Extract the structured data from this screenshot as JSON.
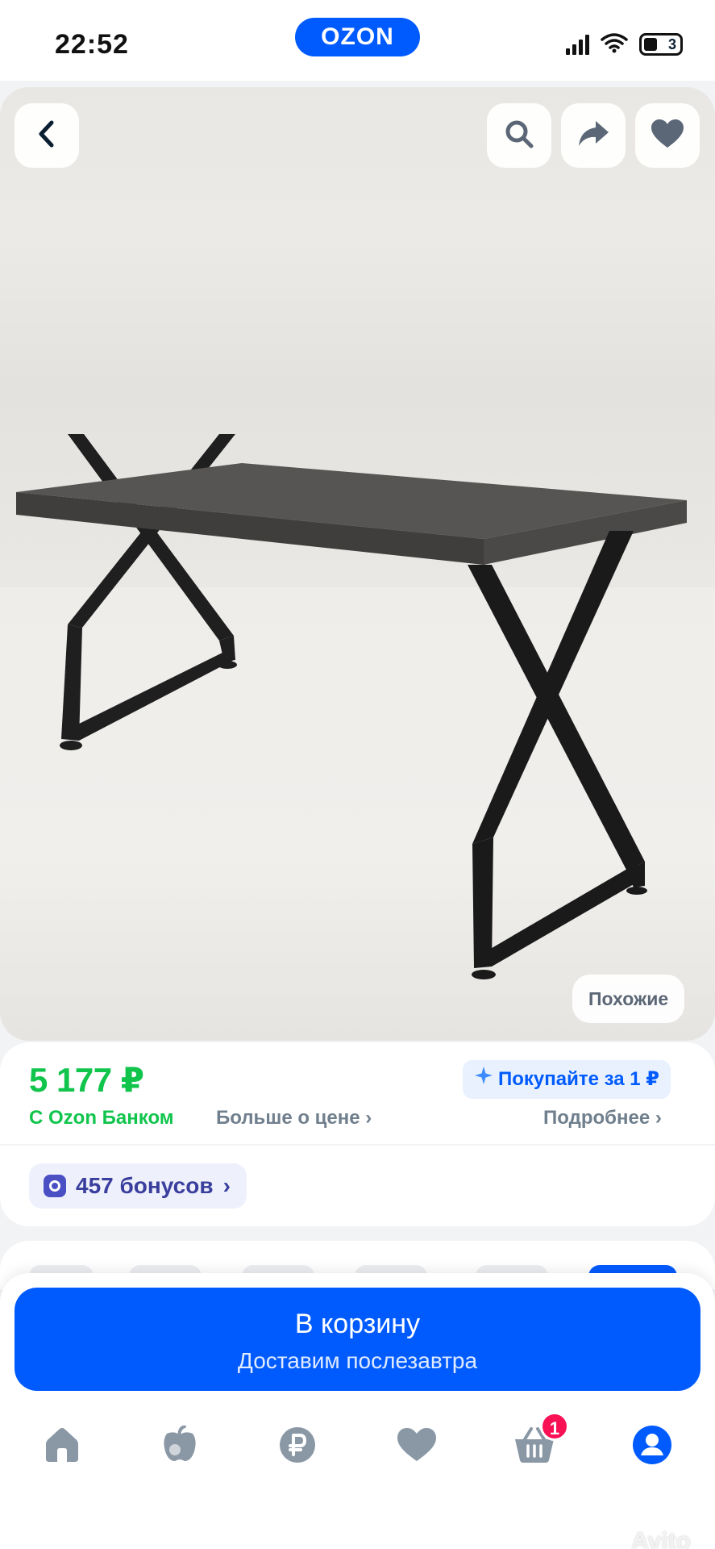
{
  "status_bar": {
    "time": "22:52",
    "battery": "3"
  },
  "brand": {
    "logo_text": "OZON",
    "accent": "#005bff"
  },
  "product_image": {
    "actions": [
      "back",
      "search",
      "share",
      "favorite"
    ],
    "similar_label": "Похожие"
  },
  "price_card": {
    "price": "5 177 ₽",
    "price_color": "#10c44c",
    "bank_label": "С Ozon Банком",
    "more_price_label": "Больше о цене",
    "promo_label": "Покупайте за 1 ₽",
    "details_label": "Подробнее",
    "bonus_label": "457 бонусов"
  },
  "bottom_sheet": {
    "cart_label": "В корзину",
    "cart_sub": "Доставим послезавтра"
  },
  "tabbar": {
    "items": [
      "home",
      "fresh",
      "finance",
      "favorites",
      "cart",
      "profile"
    ],
    "cart_badge": "1",
    "active": "profile"
  },
  "watermark": "Avito"
}
